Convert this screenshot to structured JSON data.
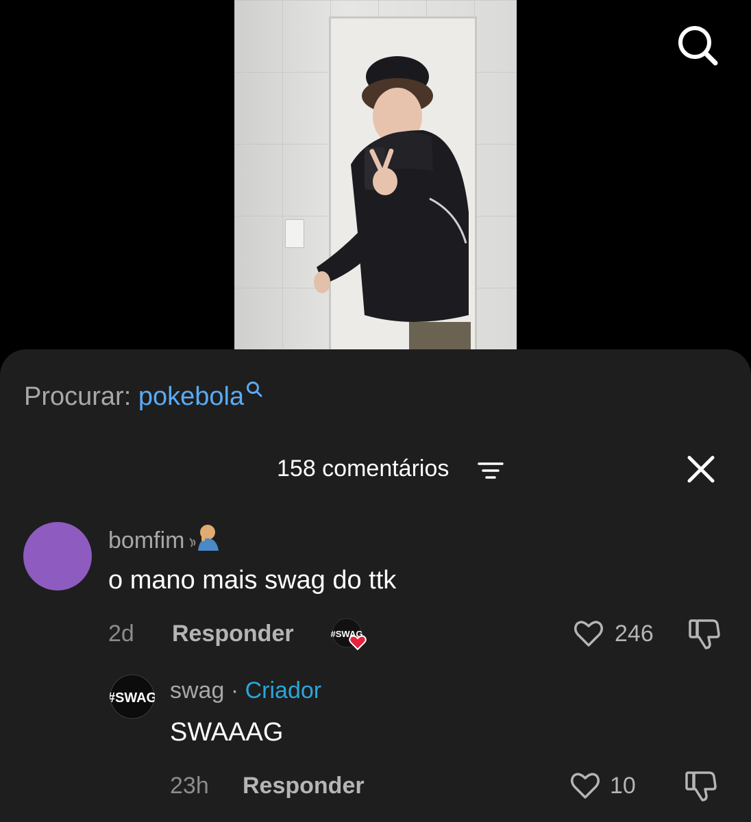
{
  "search_hint": {
    "prefix": "Procurar:",
    "term": "pokebola"
  },
  "comments_header": {
    "count_label": "158 comentários"
  },
  "comments": [
    {
      "username": "bomfim",
      "text": "o mano mais swag do ttk",
      "age": "2d",
      "reply_label": "Responder",
      "likes": "246",
      "reply": {
        "username": "swag",
        "separator": "·",
        "badge": "Criador",
        "avatar_text": "#SWAG",
        "text": "SWAAAG",
        "age": "23h",
        "reply_label": "Responder",
        "likes": "10"
      }
    }
  ],
  "colors": {
    "sheet_bg": "#1e1e1e",
    "link_blue": "#5aabf5",
    "creator_blue": "#2aa6d9",
    "avatar_purple": "#8e5cc0",
    "liked_heart": "#e8223c"
  },
  "icons": [
    "search-icon",
    "filter-icon",
    "close-icon",
    "heart-icon",
    "dislike-icon",
    "magnifier-icon"
  ]
}
